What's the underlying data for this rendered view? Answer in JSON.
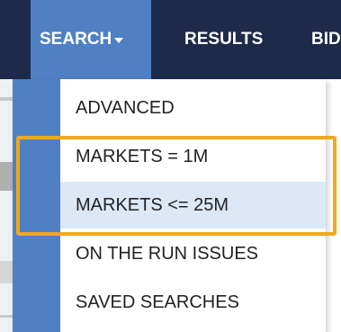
{
  "nav": {
    "tabs": [
      {
        "label": "SEARCH"
      },
      {
        "label": "RESULTS"
      },
      {
        "label": "BID"
      }
    ]
  },
  "menu": {
    "items": [
      {
        "label": "ADVANCED"
      },
      {
        "label": "MARKETS = 1M"
      },
      {
        "label": "MARKETS <= 25M"
      },
      {
        "label": "ON THE RUN ISSUES"
      },
      {
        "label": "SAVED SEARCHES"
      }
    ],
    "hovered_index": 2
  },
  "colors": {
    "nav_background": "#1d2a4a",
    "active_tab": "#4f80c4",
    "hover_row": "#dce8f6",
    "highlight_border": "#f0a81c"
  }
}
